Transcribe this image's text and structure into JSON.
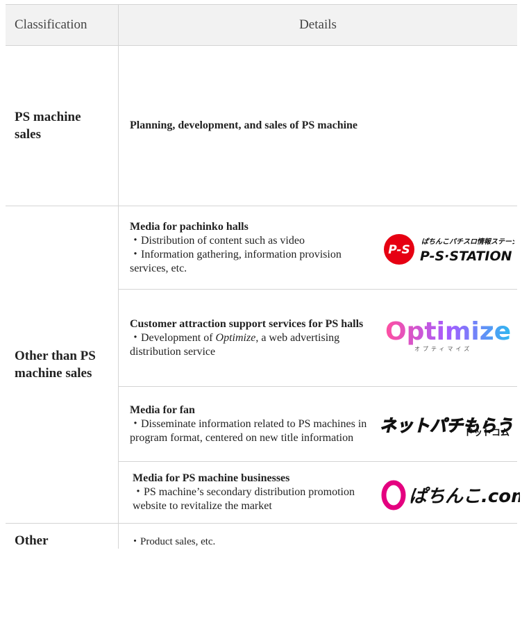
{
  "header": {
    "classification": "Classification",
    "details": "Details"
  },
  "rows": [
    {
      "classification": "PS machine sales",
      "detail": "Planning, development, and sales of PS machine"
    },
    {
      "classification": "Other than PS machine sales",
      "items": [
        {
          "title": "Media for pachinko halls",
          "lines": [
            "・Distribution of content such as video",
            "・Information gathering, information provision services, etc."
          ],
          "logo_text": "P-S",
          "logo_tagline": "ぱちんこパチスロ情報ステーション",
          "logo_name": "P-S·STATION"
        },
        {
          "title": "Customer attraction support services for PS halls",
          "line_prefix": "・Development of ",
          "line_em": "Optimize",
          "line_suffix": ", a web advertising distribution service",
          "logo_name": "Optimize",
          "logo_sub": "オプティマイズ"
        },
        {
          "title": "Media for fan",
          "lines": [
            "・Disseminate information related to PS machines in program format, centered on new title information"
          ],
          "logo_text": "ネットパチもらう",
          "logo_sub": "ドットコム"
        },
        {
          "title": "Media for PS machine businesses",
          "lines": [
            "・PS machine’s secondary distribution promotion website to revitalize the market"
          ],
          "logo_name": "ぱちんこ.com"
        }
      ]
    },
    {
      "classification": "Other",
      "detail": "・Product sales, etc."
    }
  ],
  "colors": {
    "border": "#d4d4d4",
    "header_bg": "#f2f2f2",
    "ps_red": "#e60012",
    "pachinko_magenta": "#e4007f"
  }
}
